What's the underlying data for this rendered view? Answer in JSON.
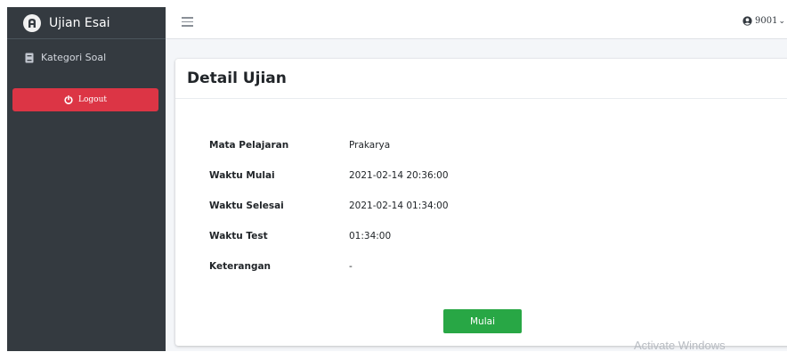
{
  "sidebar": {
    "brand": "Ujian Esai",
    "brand_icon": "logo-icon",
    "items": [
      {
        "label": "Kategori Soal",
        "icon": "book-icon"
      }
    ],
    "logout_label": "Logout",
    "logout_icon": "power-icon",
    "background": "#343a40",
    "logout_color": "#dc3545"
  },
  "topbar": {
    "menu_icon": "hamburger-icon",
    "user_icon": "user-circle-icon",
    "user_name": "9001",
    "user_caret": "❯"
  },
  "main": {
    "card_title": "Detail Ujian",
    "details": [
      {
        "label": "Mata Pelajaran",
        "value": "Prakarya"
      },
      {
        "label": "Waktu Mulai",
        "value": "2021-02-14 20:36:00"
      },
      {
        "label": "Waktu Selesai",
        "value": "2021-02-14 01:34:00"
      },
      {
        "label": "Waktu Test",
        "value": "01:34:00"
      },
      {
        "label": "Keterangan",
        "value": "-"
      }
    ],
    "start_button": "Mulai",
    "start_color": "#28a745"
  },
  "watermark": "Activate Windows"
}
